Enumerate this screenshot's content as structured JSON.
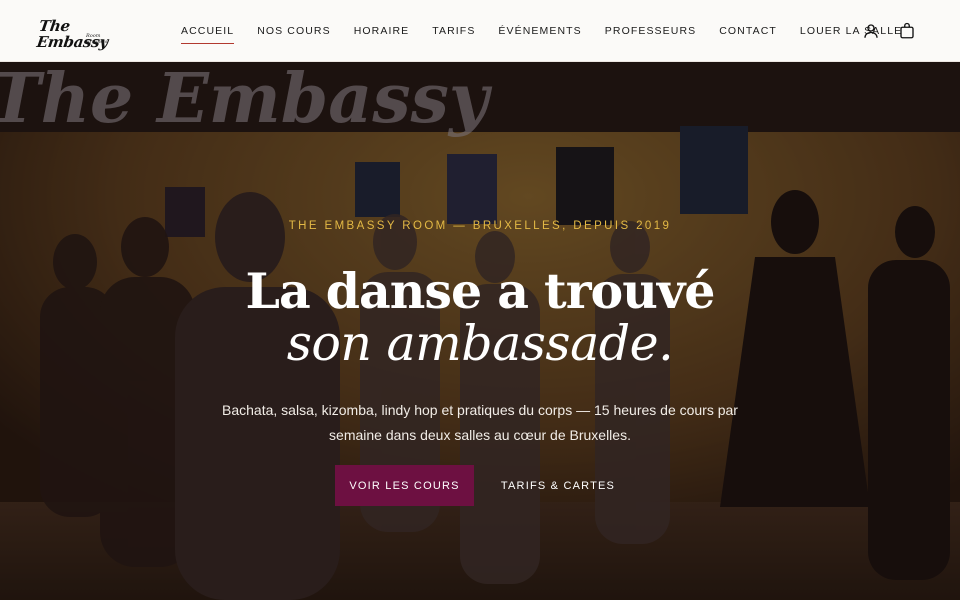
{
  "header": {
    "logo": {
      "main": "The Embassy",
      "sub": "Room Brussels"
    },
    "nav": [
      {
        "label": "ACCUEIL",
        "active": true
      },
      {
        "label": "NOS COURS"
      },
      {
        "label": "HORAIRE"
      },
      {
        "label": "TARIFS"
      },
      {
        "label": "ÉVÉNEMENTS"
      },
      {
        "label": "PROFESSEURS"
      },
      {
        "label": "CONTACT"
      },
      {
        "label": "LOUER LA SALLE"
      }
    ],
    "icons": [
      "account-icon",
      "cart-icon"
    ]
  },
  "hero": {
    "eyebrow": "THE EMBASSY ROOM — BRUXELLES, DEPUIS 2019",
    "title_line1": "La danse a trouvé",
    "title_line2": "son ambassade.",
    "description": "Bachata, salsa, kizomba, lindy hop et pratiques du corps — 15 heures de cours par semaine dans deux salles au cœur de Bruxelles.",
    "primary_cta": "VOIR LES COURS",
    "secondary_cta": "TARIFS & CARTES",
    "wall_sign": "The Embassy"
  },
  "colors": {
    "accent": "#6d1041",
    "eyebrow": "#e3b945",
    "nav_active_underline": "#b2392f",
    "header_bg": "#fbfaf8"
  }
}
